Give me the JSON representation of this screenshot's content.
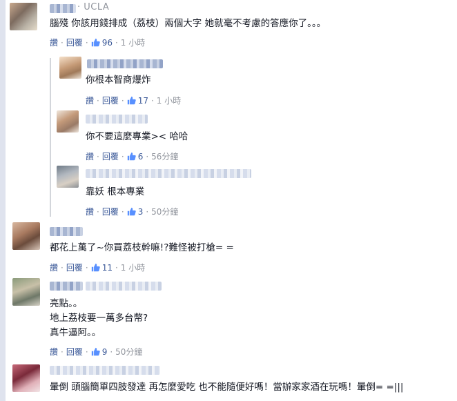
{
  "comments": [
    {
      "affiliation": "· UCLA",
      "text": "腦殘 你該用錢排成（荔枝）兩個大字 她就毫不考慮的答應你了。。。",
      "actions": {
        "read": "讚",
        "reply": "回覆",
        "likes": "96",
        "time": "1 小時"
      }
    },
    {
      "text": "你根本智商爆炸",
      "actions": {
        "read": "讚",
        "reply": "回覆",
        "likes": "17",
        "time": "1 小時"
      }
    },
    {
      "text": "你不要這麼專業>< 哈哈",
      "actions": {
        "read": "讚",
        "reply": "回覆",
        "likes": "6",
        "time": "56分鐘"
      }
    },
    {
      "text": "靠妖 根本專業",
      "actions": {
        "read": "讚",
        "reply": "回覆",
        "likes": "3",
        "time": "50分鐘"
      }
    },
    {
      "text": "都花上萬了~你買荔枝幹嘛!?難怪被打槍= =",
      "actions": {
        "read": "讚",
        "reply": "回覆",
        "likes": "11",
        "time": "1 小時"
      }
    },
    {
      "lines": [
        "亮點。。",
        "地上荔枝要一萬多台幣?",
        "真牛逼阿。。"
      ],
      "actions": {
        "read": "讚",
        "reply": "回覆",
        "likes": "9",
        "time": "50分鐘"
      }
    },
    {
      "text": "暈倒 頭腦簡單四肢發達 再怎麼愛吃 也不能隨便好嗎！當辦家家酒在玩嗎！暈倒= =|||"
    }
  ],
  "colors": {
    "link": "#3b5998",
    "meta": "#90949c",
    "text": "#141823"
  },
  "icons": {
    "like": "thumbs-up-icon"
  }
}
